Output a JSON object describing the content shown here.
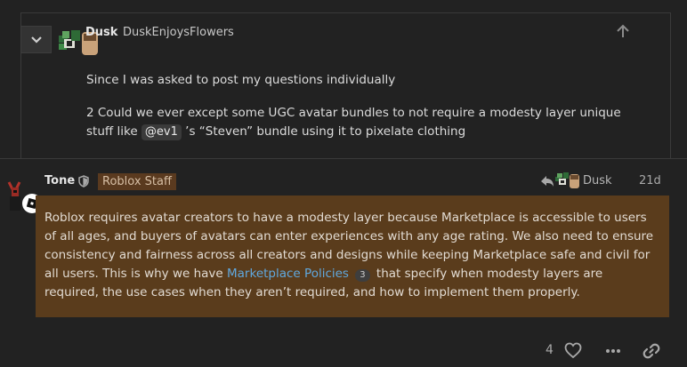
{
  "quote": {
    "username": "Dusk",
    "full_name": "DuskEnjoysFlowers",
    "paragraph1": "Since I was asked to post my questions individually",
    "paragraph2_before": "2 Could we ever except some UGC avatar bundles to not require a modesty layer unique stuff like ",
    "mention": "@ev1",
    "paragraph2_after": " ’s “Steven” bundle using it to pixelate clothing"
  },
  "post": {
    "username": "Tone",
    "flair": "Roblox Staff",
    "reply_to": "Dusk",
    "date": "21d",
    "body_before": "Roblox requires avatar creators to have a modesty layer because Marketplace is accessible to users of all ages, and buyers of avatars can enter experiences with any age rating. We also need to ensure consistency and fairness across all creators and designs while keeping Marketplace safe and civil for all users. This is why we have ",
    "link_text": "Marketplace Policies",
    "link_badge": "3",
    "body_after": " that specify when modesty layers are required, the use cases when they aren’t required, and how to implement them properly."
  },
  "actions": {
    "like_count": "4"
  },
  "icons": {
    "collapse": "chevron-down-icon",
    "go_to_quoted": "arrow-up-icon",
    "staff_shield": "shield-icon",
    "reply": "reply-arrow-icon",
    "like": "heart-icon",
    "more": "ellipsis-icon",
    "share": "link-icon"
  },
  "colors": {
    "background": "#222222",
    "staff_post_background": "#5a3c1c",
    "flair_background": "#5a3a1f",
    "link": "#60a8de"
  }
}
